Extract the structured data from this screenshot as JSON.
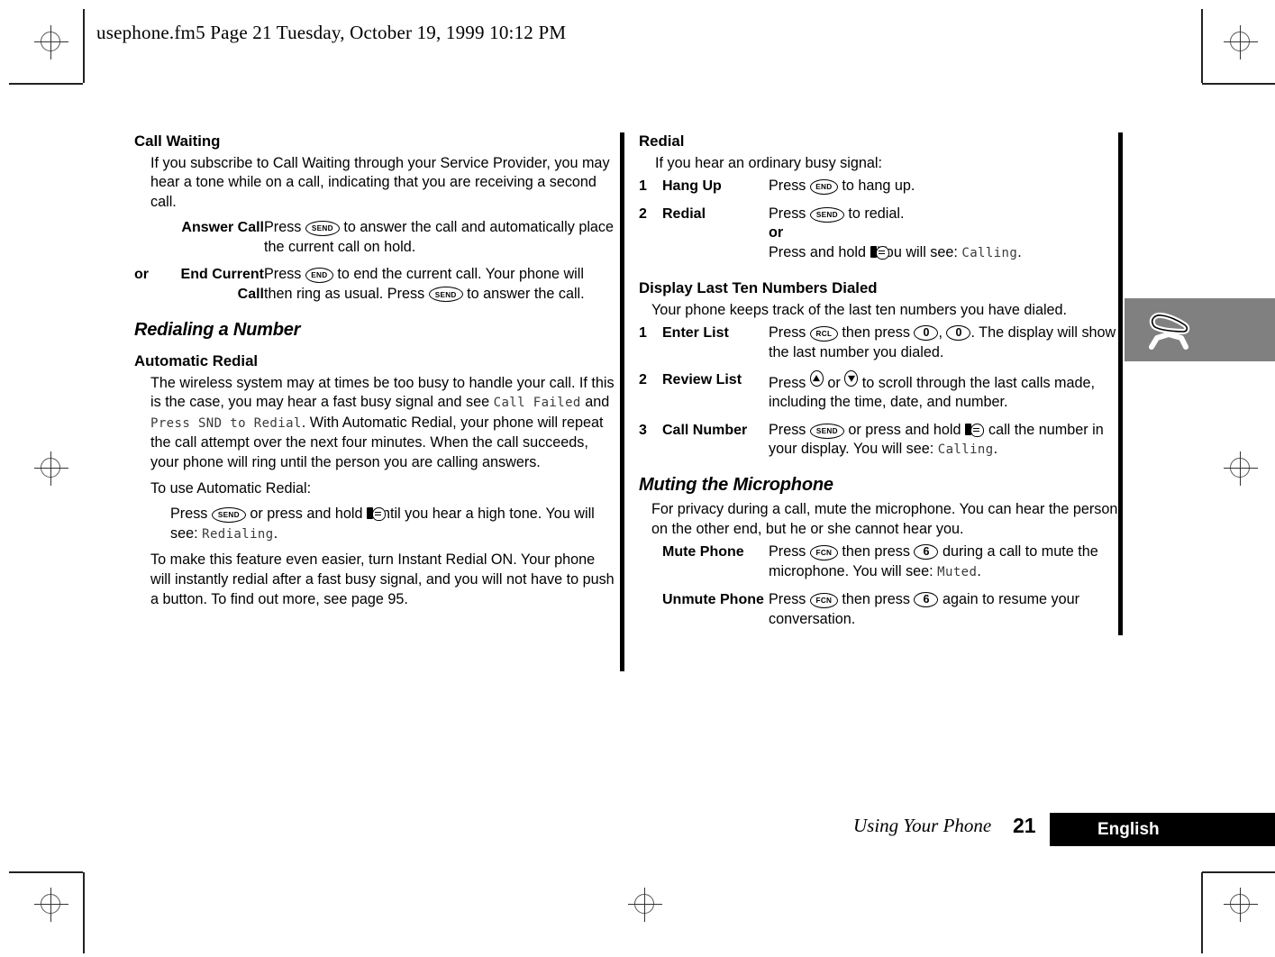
{
  "page_header": "usephone.fm5  Page 21  Tuesday, October 19, 1999  10:12 PM",
  "left_column": {
    "call_waiting": {
      "heading": "Call Waiting",
      "intro": "If you subscribe to Call Waiting through your Service Provider, you may hear a tone while on a call, indicating that you are receiving a second call.",
      "rows": [
        {
          "num": "",
          "label": "Answer Call",
          "desc_pre": "Press",
          "key": "SEND",
          "desc_post": "to answer the call and automatically place the current call on hold."
        },
        {
          "num": "or",
          "label": "End Current Call",
          "desc_pre": "Press",
          "key": "END",
          "desc_mid": "to end the current call. Your phone will then ring as usual. Press",
          "key2": "SEND",
          "desc_post": "to answer the call."
        }
      ]
    },
    "redialing": {
      "heading": "Redialing a Number",
      "subheading": "Automatic Redial",
      "para1_a": "The wireless system may at times be too busy to handle your call. If this is the case, you may hear a fast busy signal and see ",
      "para1_lcd1": "Call Failed",
      "para1_b": " and ",
      "para1_lcd2": "Press SND to Redial",
      "para1_c": ". With Automatic Redial, your phone will repeat the call attempt over the next four minutes. When the call succeeds, your phone will ring until the person you are calling answers.",
      "para2": "To use Automatic Redial:",
      "para3_a": "Press",
      "para3_key": "SEND",
      "para3_b": "or press and hold",
      "para3_c": "until you hear a high tone. You will see: ",
      "para3_lcd": "Redialing",
      "para3_d": ".",
      "para4": "To make this feature even easier, turn Instant Redial ON. Your phone will instantly redial after a fast busy signal, and you will not have to push a button. To find out more, see page 95."
    }
  },
  "right_column": {
    "redial": {
      "heading": "Redial",
      "intro": "If you hear an ordinary busy signal:",
      "rows": [
        {
          "num": "1",
          "label": "Hang Up",
          "desc_pre": "Press",
          "key": "END",
          "desc_post": "to hang up."
        },
        {
          "num": "2",
          "label": "Redial",
          "desc_pre": "Press",
          "key": "SEND",
          "desc_post": "to redial.",
          "or_word": "or",
          "alt_pre": "Press and hold",
          "alt_post": "You will see: ",
          "alt_lcd": "Calling",
          "alt_end": "."
        }
      ]
    },
    "display_last_ten": {
      "heading": "Display Last Ten Numbers Dialed",
      "intro": "Your phone keeps track of the last ten numbers you have dialed.",
      "rows": [
        {
          "num": "1",
          "label": "Enter List",
          "desc_pre": "Press",
          "key": "RCL",
          "desc_mid": "then press",
          "key2": "0",
          "key2_sep": ",",
          "key3": "0",
          "desc_post": ". The display will show the last number you dialed."
        },
        {
          "num": "2",
          "label": "Review List",
          "desc_pre": "Press",
          "key_up": "up-arrow",
          "desc_mid": "or",
          "key_down": "down-arrow",
          "desc_post": "to scroll through the last calls made, including the time, date, and number."
        },
        {
          "num": "3",
          "label": "Call Number",
          "desc_pre": "Press",
          "key": "SEND",
          "desc_mid": "or press and hold",
          "desc_post": "to call the number in your display. You will see: ",
          "lcd": "Calling",
          "desc_end": "."
        }
      ]
    },
    "muting": {
      "heading": "Muting the Microphone",
      "intro": "For privacy during a call, mute the microphone. You can hear the person on the other end, but he or she cannot hear you.",
      "rows": [
        {
          "label": "Mute Phone",
          "desc_pre": "Press",
          "key": "FCN",
          "desc_mid": "then press",
          "key2": "6",
          "desc_post": "during a call to mute the microphone. You will see: ",
          "lcd": "Muted",
          "desc_end": "."
        },
        {
          "label": "Unmute Phone",
          "desc_pre": "Press",
          "key": "FCN",
          "desc_mid": "then press",
          "key2": "6",
          "desc_post": "again to resume your conversation."
        }
      ]
    }
  },
  "thumb_tab": {
    "icon": "phone-handset-icon",
    "color": "#808080"
  },
  "footer": {
    "chapter": "Using Your Phone",
    "page_number": "21",
    "language": "English"
  }
}
